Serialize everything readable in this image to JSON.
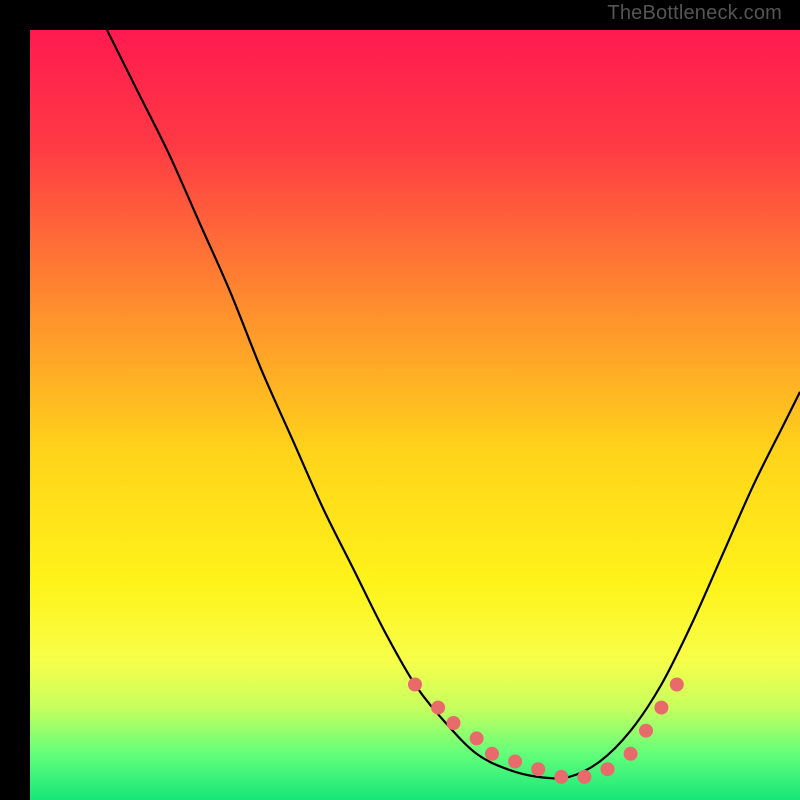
{
  "watermark": "TheBottleneck.com",
  "chart_data": {
    "type": "line",
    "title": "",
    "xlabel": "",
    "ylabel": "",
    "xlim": [
      0,
      100
    ],
    "ylim": [
      0,
      100
    ],
    "grid": false,
    "legend": false,
    "background_gradient": {
      "stops": [
        {
          "offset": 0.0,
          "color": "#ff1a50"
        },
        {
          "offset": 0.15,
          "color": "#ff3a44"
        },
        {
          "offset": 0.35,
          "color": "#ff8a2f"
        },
        {
          "offset": 0.55,
          "color": "#ffd41a"
        },
        {
          "offset": 0.72,
          "color": "#fff31a"
        },
        {
          "offset": 0.82,
          "color": "#f6ff4a"
        },
        {
          "offset": 0.88,
          "color": "#c7ff5e"
        },
        {
          "offset": 0.94,
          "color": "#63ff7a"
        },
        {
          "offset": 1.0,
          "color": "#16e67a"
        }
      ]
    },
    "series": [
      {
        "name": "curve",
        "type": "line",
        "color": "#000000",
        "x": [
          10,
          14,
          18,
          22,
          26,
          30,
          34,
          38,
          42,
          46,
          50,
          54,
          58,
          62,
          66,
          70,
          74,
          78,
          82,
          86,
          90,
          94,
          98,
          100
        ],
        "y": [
          100,
          92,
          84,
          75,
          66,
          56,
          47,
          38,
          30,
          22,
          15,
          10,
          6,
          4,
          3,
          3,
          5,
          9,
          15,
          23,
          32,
          41,
          49,
          53
        ]
      },
      {
        "name": "markers",
        "type": "scatter",
        "color": "#e86a6a",
        "x": [
          50,
          53,
          55,
          58,
          60,
          63,
          66,
          69,
          72,
          75,
          78,
          80,
          82,
          84
        ],
        "y": [
          15,
          12,
          10,
          8,
          6,
          5,
          4,
          3,
          3,
          4,
          6,
          9,
          12,
          15
        ]
      }
    ]
  }
}
